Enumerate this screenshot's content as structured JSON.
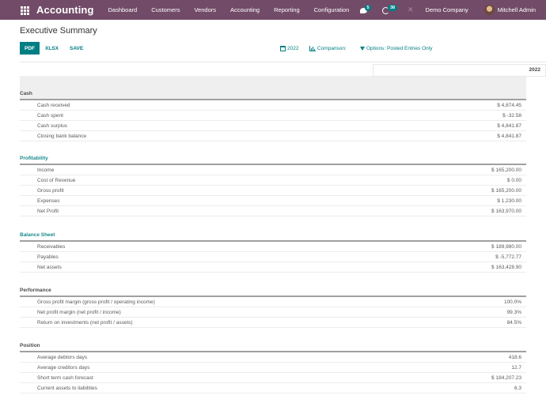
{
  "navbar": {
    "app_name": "Accounting",
    "menu": [
      "Dashboard",
      "Customers",
      "Vendors",
      "Accounting",
      "Reporting",
      "Configuration"
    ],
    "messages_badge": "5",
    "activities_badge": "38",
    "company": "Demo Company",
    "user": "Mitchell Admin"
  },
  "page": {
    "title": "Executive Summary"
  },
  "toolbar": {
    "pdf_label": "PDF",
    "xlsx_label": "XLSX",
    "save_label": "SAVE"
  },
  "filters": {
    "period": "2022",
    "comparison": "Comparison:",
    "options": "Options: Posted Entries Only"
  },
  "report": {
    "column_header": "2022",
    "sections": [
      {
        "title": "Cash",
        "rows": [
          {
            "label": "Cash received",
            "value": "$ 4,874.45"
          },
          {
            "label": "Cash spent",
            "value": "$ -32.58"
          },
          {
            "label": "Cash surplus",
            "value": "$ 4,841.87"
          },
          {
            "label": "Closing bank balance",
            "value": "$ 4,841.87"
          }
        ]
      },
      {
        "title": "Profitability",
        "rows": [
          {
            "label": "Income",
            "value": "$ 165,200.00"
          },
          {
            "label": "Cost of Revenue",
            "value": "$ 0.00"
          },
          {
            "label": "Gross profit",
            "value": "$ 165,200.00"
          },
          {
            "label": "Expenses",
            "value": "$ 1,230.00"
          },
          {
            "label": "Net Profit",
            "value": "$ 163,970.00"
          }
        ]
      },
      {
        "title": "Balance Sheet",
        "rows": [
          {
            "label": "Receivables",
            "value": "$ 189,980.00"
          },
          {
            "label": "Payables",
            "value": "$ -5,772.77"
          },
          {
            "label": "Net assets",
            "value": "$ 163,428.90"
          }
        ]
      },
      {
        "title": "Performance",
        "rows": [
          {
            "label": "Gross profit margin (gross profit / operating income)",
            "value": "100.0%"
          },
          {
            "label": "Net profit margin (net profit / income)",
            "value": "99.3%"
          },
          {
            "label": "Return on investments (net profit / assets)",
            "value": "84.5%"
          }
        ]
      },
      {
        "title": "Position",
        "rows": [
          {
            "label": "Average debtors days",
            "value": "418.6"
          },
          {
            "label": "Average creditors days",
            "value": "12.7"
          },
          {
            "label": "Short term cash forecast",
            "value": "$ 184,207.23"
          },
          {
            "label": "Current assets to liabilities",
            "value": "6.3"
          }
        ]
      }
    ]
  }
}
